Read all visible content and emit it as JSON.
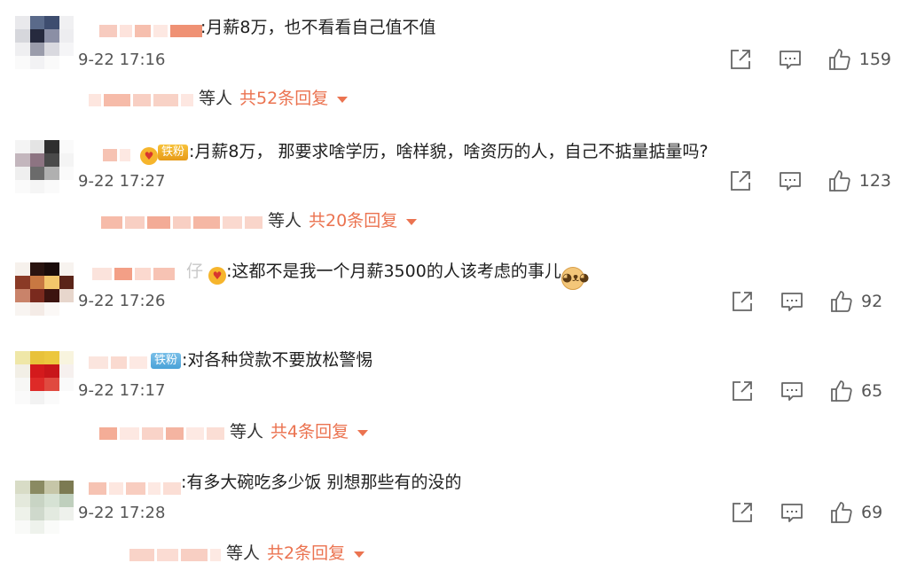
{
  "comments": [
    {
      "badge": "",
      "text": ":月薪8万，也不看看自己值不值",
      "time": "9-22 17:16",
      "likes": "159",
      "reply_people": "等人",
      "reply_total": "共52条回复"
    },
    {
      "badge": "铁粉",
      "text": ":月薪8万， 那要求啥学历，啥样貌，啥资历的人，自己不掂量掂量吗?",
      "time": "9-22 17:27",
      "likes": "123",
      "reply_people": "等人",
      "reply_total": "共20条回复"
    },
    {
      "badge": "",
      "text": ":这都不是我一个月薪3500的人该考虑的事儿",
      "time": "9-22 17:26",
      "likes": "92"
    },
    {
      "badge": "铁粉",
      "text": ":对各种贷款不要放松警惕",
      "time": "9-22 17:17",
      "likes": "65",
      "reply_people": "等人",
      "reply_total": "共4条回复"
    },
    {
      "badge": "",
      "text": ":有多大碗吃多少饭 别想那些有的没的",
      "time": "9-22 17:28",
      "likes": "69",
      "reply_people": "等人",
      "reply_total": "共2条回复"
    }
  ],
  "username_fragments": {
    "c3_tail": "仔"
  },
  "icons": {
    "share": "share-icon",
    "comment": "comment-icon",
    "like": "thumbs-up-icon",
    "expand": "caret-down-icon"
  },
  "colors": {
    "accent": "#eb7350",
    "text": "#1f1f1f",
    "muted": "#555555",
    "badge_gold": "#f0ad2a",
    "badge_blue": "#5aaee0"
  }
}
